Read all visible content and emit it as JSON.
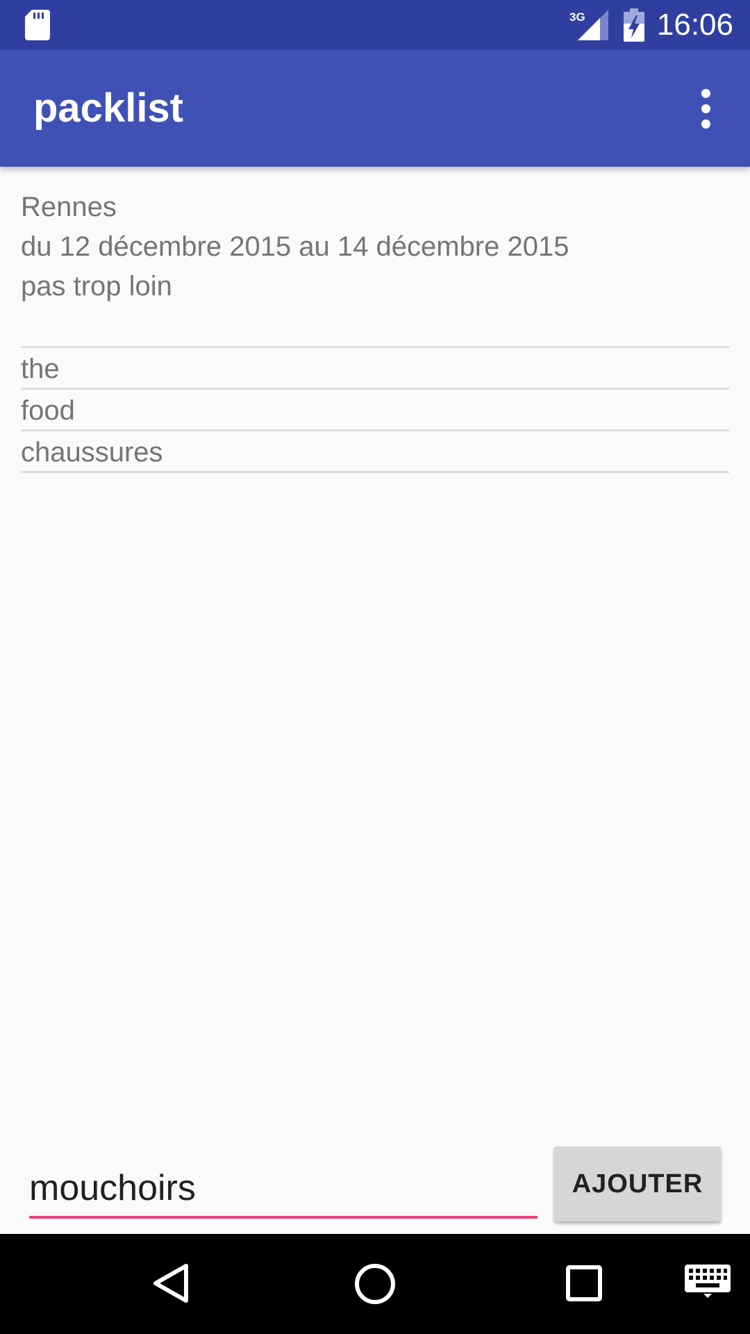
{
  "status_bar": {
    "time": "16:06",
    "network_label": "3G",
    "icons": [
      "sd-card-icon",
      "cellular-signal-icon",
      "battery-charging-icon"
    ]
  },
  "app_bar": {
    "title": "packlist",
    "menu_icon": "overflow-menu-icon"
  },
  "trip": {
    "destination": "Rennes",
    "dates": "du 12 décembre 2015 au 14 décembre 2015",
    "note": "pas trop loin"
  },
  "items": [
    {
      "label": "the"
    },
    {
      "label": "food"
    },
    {
      "label": "chaussures"
    }
  ],
  "input": {
    "value": "mouchoirs"
  },
  "add_button": {
    "label": "AJOUTER"
  },
  "nav_bar": {
    "icons": [
      "back-icon",
      "home-icon",
      "recents-icon",
      "keyboard-icon"
    ]
  },
  "colors": {
    "status_bar": "#303f9f",
    "app_bar": "#3f51b5",
    "accent": "#ec407a",
    "background": "#fafafa"
  }
}
